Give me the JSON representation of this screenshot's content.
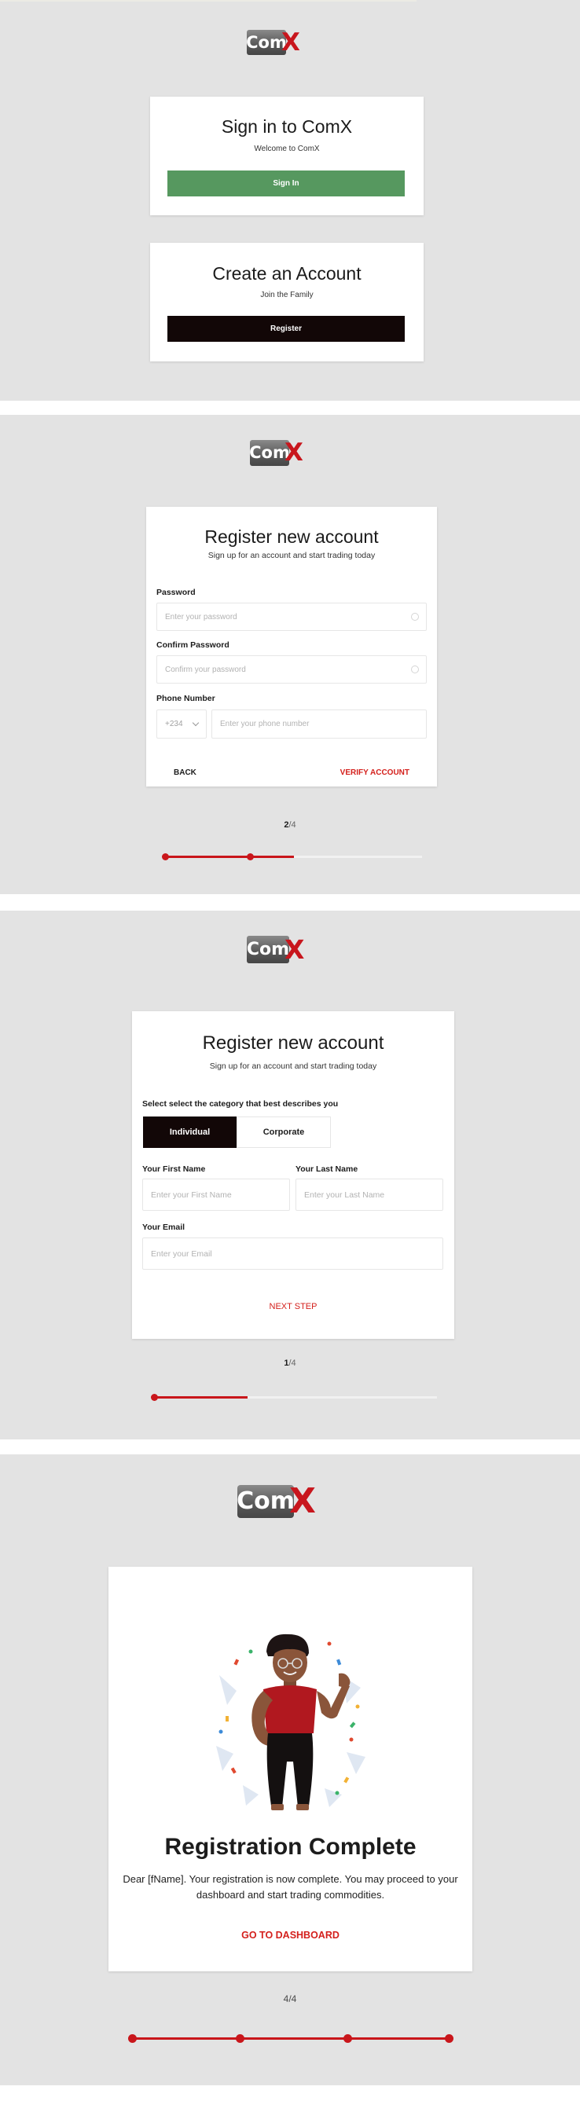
{
  "brand": {
    "logo_main": "Com",
    "logo_x": "X",
    "accent_red": "#c9161b",
    "green": "#56985f",
    "dark": "#120707"
  },
  "screen1": {
    "signin": {
      "title": "Sign in to ComX",
      "subtitle": "Welcome to ComX",
      "button": "Sign In"
    },
    "register": {
      "title": "Create an Account",
      "subtitle": "Join the Family",
      "button": "Register"
    }
  },
  "screen2": {
    "title": "Register new account",
    "subtitle": "Sign up for an account and start trading today",
    "password_label": "Password",
    "password_placeholder": "Enter your password",
    "confirm_label": "Confirm Password",
    "confirm_placeholder": "Confirm your password",
    "phone_label": "Phone Number",
    "country_code": "+234",
    "phone_placeholder": "Enter your phone number",
    "back": "BACK",
    "verify": "VERIFY ACCOUNT",
    "step_current": "2",
    "step_total": "/4",
    "progress": 0.5
  },
  "screen3": {
    "title": "Register new account",
    "subtitle": "Sign up for an account and start trading today",
    "category_label": "Select select the category that best describes you",
    "tab_individual": "Individual",
    "tab_corporate": "Corporate",
    "first_label": "Your First Name",
    "first_placeholder": "Enter your First Name",
    "last_label": "Your Last Name",
    "last_placeholder": "Enter your Last Name",
    "email_label": "Your Email",
    "email_placeholder": "Enter your Email",
    "next": "NEXT STEP",
    "step_current": "1",
    "step_total": "/4",
    "progress": 0.33
  },
  "screen4": {
    "title": "Registration Complete",
    "message": "Dear [fName]. Your registration is now complete. You may proceed to your dashboard and start trading commodities.",
    "cta": "GO TO DASHBOARD",
    "step": "4/4",
    "progress": 1.0
  }
}
